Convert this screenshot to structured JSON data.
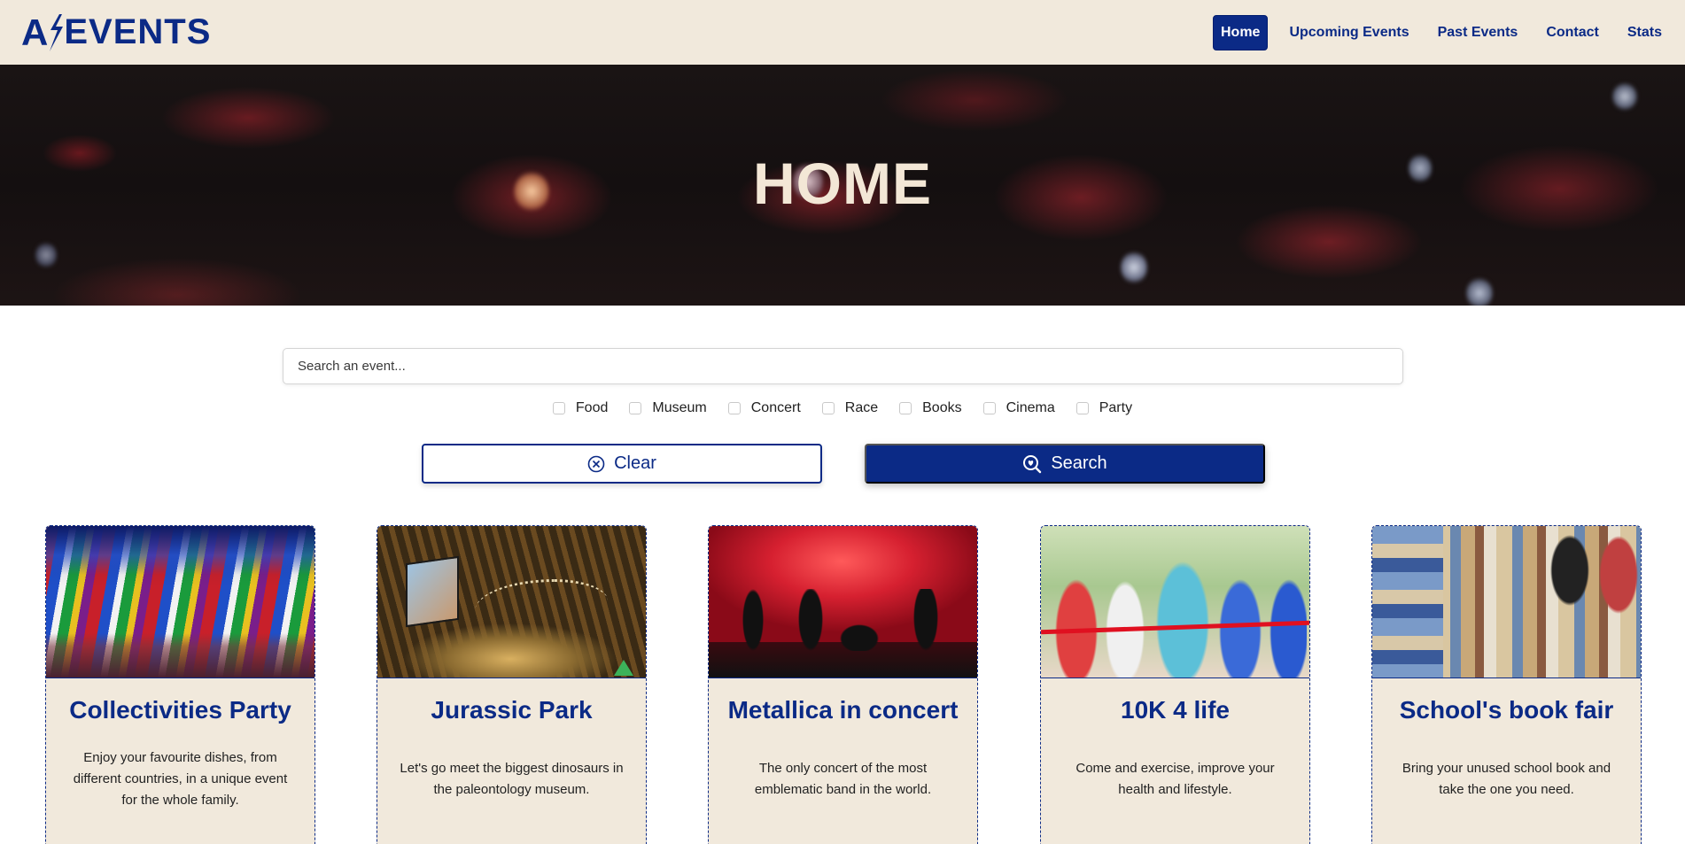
{
  "brand": {
    "name": "EVENTS",
    "prefix": "A"
  },
  "nav": {
    "items": [
      {
        "label": "Home",
        "active": true
      },
      {
        "label": "Upcoming Events",
        "active": false
      },
      {
        "label": "Past Events",
        "active": false
      },
      {
        "label": "Contact",
        "active": false
      },
      {
        "label": "Stats",
        "active": false
      }
    ]
  },
  "hero": {
    "title": "HOME"
  },
  "search": {
    "placeholder": "Search an event...",
    "value": ""
  },
  "filters": [
    "Food",
    "Museum",
    "Concert",
    "Race",
    "Books",
    "Cinema",
    "Party"
  ],
  "buttons": {
    "clear": "Clear",
    "search": "Search"
  },
  "cards": [
    {
      "title": "Collectivities Party",
      "description": "Enjoy your favourite dishes, from different countries, in a unique event for the whole family."
    },
    {
      "title": "Jurassic Park",
      "description": "Let's go meet the biggest dinosaurs in the paleontology museum."
    },
    {
      "title": "Metallica in concert",
      "description": "The only concert of the most emblematic band in the world."
    },
    {
      "title": "10K 4 life",
      "description": "Come and exercise, improve your health and lifestyle."
    },
    {
      "title": "School's book fair",
      "description": "Bring your unused school book and take the one you need."
    }
  ],
  "colors": {
    "primary": "#0b2a86",
    "cream": "#f1e9dc"
  }
}
